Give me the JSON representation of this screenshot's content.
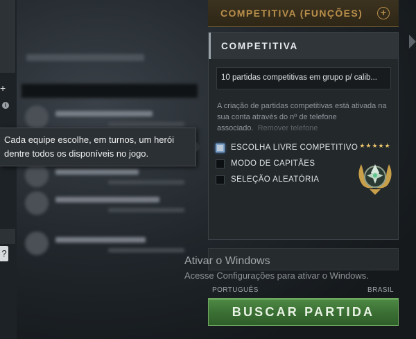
{
  "top_button": {
    "label": "COMPETITIVA (FUNÇÕES)",
    "icon": "plus-circle-icon"
  },
  "panel": {
    "title": "COMPETITIVA",
    "select_value": "10 partidas competitivas em grupo p/ calib...",
    "info_text": "A criação de partidas competitivas está ativada na sua conta através do nº de telefone associado.",
    "remove_phone": "Remover telefone",
    "options": [
      {
        "label": "ESCOLHA LIVRE COMPETITIVO",
        "checked": true
      },
      {
        "label": "MODO DE CAPITÃES",
        "checked": false
      },
      {
        "label": "SELEÇÃO ALEATÓRIA",
        "checked": false
      }
    ],
    "rank_stars": "★★★★★"
  },
  "tooltip": {
    "text": "Cada equipe escolhe, em turnos, um herói dentre todos os disponíveis no jogo."
  },
  "left_edge": {
    "plus": "+",
    "info": "i",
    "help": "?"
  },
  "watermark": {
    "line1": "Ativar o Windows",
    "line2": "Acesse Configurações para ativar o Windows."
  },
  "region": {
    "language": "PORTUGUÊS",
    "server": "BRASIL"
  },
  "find_match": {
    "label": "BUSCAR PARTIDA"
  },
  "colors": {
    "gold": "#b88f4a",
    "green_button": "#3a6e33",
    "panel_bg": "#23282b"
  }
}
